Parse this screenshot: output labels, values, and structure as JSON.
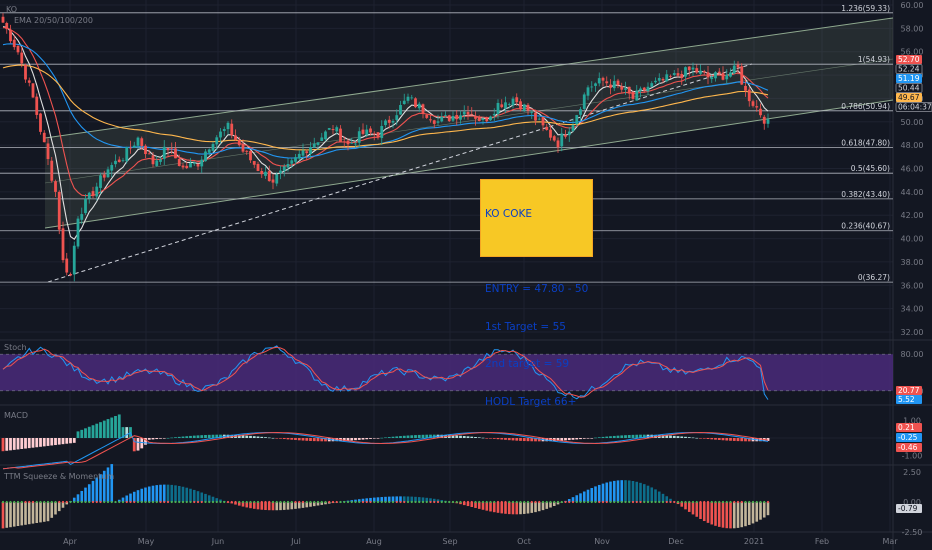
{
  "chart_data": {
    "type": "candlestick",
    "symbol_label": "KO",
    "main_panel": {
      "ylim": [
        32.0,
        60.0
      ],
      "y_ticks": [
        "32.00",
        "34.00",
        "36.00",
        "38.00",
        "40.00",
        "42.00",
        "44.00",
        "46.00",
        "48.00",
        "50.00",
        "52.00",
        "54.00",
        "56.00",
        "58.00",
        "60.00"
      ],
      "indicator_label": "EMA 20/50/100/200",
      "fib_levels": [
        {
          "label": "1.236(59.33)",
          "value": 59.33
        },
        {
          "label": "1(54.93)",
          "value": 54.93
        },
        {
          "label": "0.786(50.94)",
          "value": 50.94
        },
        {
          "label": "0.618(47.80)",
          "value": 47.8
        },
        {
          "label": "0.5(45.60)",
          "value": 45.6
        },
        {
          "label": "0.382(43.40)",
          "value": 43.4
        },
        {
          "label": "0.236(40.67)",
          "value": 40.67
        },
        {
          "label": "0(36.27)",
          "value": 36.27
        }
      ],
      "price_tags": [
        {
          "label": "52.70",
          "value": 52.7,
          "color": "#ef5350"
        },
        {
          "label": "52.24",
          "value": 52.24,
          "color": "#ffffff"
        },
        {
          "label": "51.19",
          "value": 51.19,
          "color": "#2196f3"
        },
        {
          "label": "50.44",
          "value": 50.44,
          "color": "#ffffff"
        },
        {
          "label": "49.67",
          "value": 49.67,
          "color": "#ffb74d"
        },
        {
          "label": "06:04:37",
          "value": 48.9,
          "color": "#ffffff"
        }
      ],
      "annotation": {
        "lines": [
          "KO COKE",
          "",
          "ENTRY = 47.80 - 50",
          "1st Target = 55",
          "2nd target = 59",
          "HODL Target 66+"
        ]
      }
    },
    "stoch_panel": {
      "label": "Stoch",
      "ylim": [
        0,
        100
      ],
      "y_ticks": [
        "80.00",
        "20.00"
      ],
      "tags": [
        {
          "label": "20.77",
          "color": "#ef5350"
        },
        {
          "label": "5.52",
          "color": "#2196f3"
        }
      ],
      "band": [
        20,
        80
      ]
    },
    "macd_panel": {
      "label": "MACD",
      "y_ticks": [
        "1.00",
        "-1.00"
      ],
      "tags": [
        {
          "label": "0.21",
          "color": "#ef5350"
        },
        {
          "label": "-0.25",
          "color": "#2196f3"
        },
        {
          "label": "-0.46",
          "color": "#ef5350"
        }
      ]
    },
    "ttm_panel": {
      "label": "TTM Squeeze & Momentum",
      "y_ticks": [
        "2.50",
        "0.00",
        "-2.50"
      ],
      "tags": [
        {
          "label": "-0.79",
          "color": "#9e9e9e"
        }
      ]
    },
    "x_ticks": [
      "Apr",
      "May",
      "Jun",
      "Jul",
      "Aug",
      "Sep",
      "Oct",
      "Nov",
      "Dec",
      "2021",
      "Feb",
      "Mar"
    ],
    "colors": {
      "up": "#26a69a",
      "down": "#ef5350",
      "ema20": "#e0e0e0",
      "ema50": "#ef5350",
      "ema100": "#2196f3",
      "ema200": "#ffb74d",
      "fib": "#b2b5be",
      "stoch_fill": "#4a2a7a",
      "channel": "#8fa98f"
    }
  }
}
